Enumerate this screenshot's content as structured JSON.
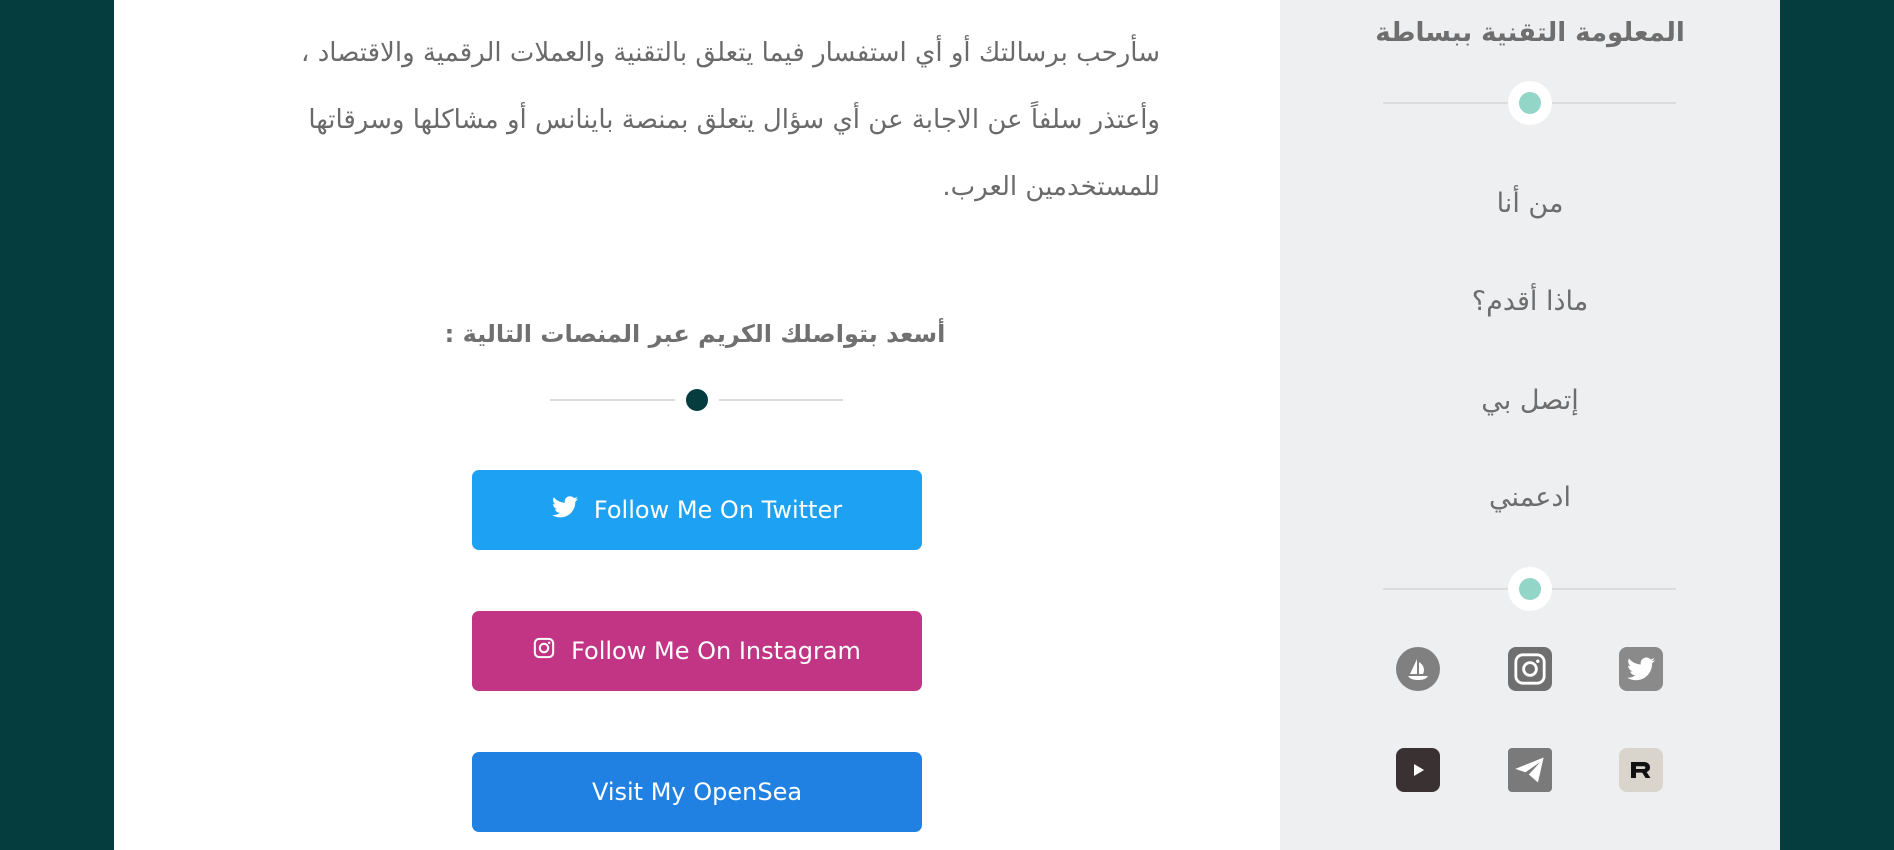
{
  "colors": {
    "outer_background": "#053d3f",
    "sidebar_background": "#eeeff1",
    "sidebar_dot": "#93d5c6",
    "main_dot": "#053d3f",
    "twitter": "#1da1f2",
    "instagram": "#c13584",
    "opensea": "#2081e2"
  },
  "main": {
    "intro_lines": [
      "سأرحب برسالتك أو أي استفسار فيما يتعلق بالتقنية والعملات الرقمية والاقتصاد ،",
      "وأعتذر سلفاً عن الاجابة عن أي سؤال يتعلق بمنصة باينانس أو مشاكلها وسرقاتها",
      "للمستخدمين العرب."
    ],
    "connect_title": "أسعد بتواصلك الكريم عبر المنصات التالية :",
    "buttons": {
      "twitter": {
        "label": "Follow Me On Twitter",
        "icon": "twitter-bird"
      },
      "instagram": {
        "label": "Follow Me On Instagram",
        "icon": "instagram-camera"
      },
      "opensea": {
        "label": "Visit My OpenSea"
      }
    }
  },
  "sidebar": {
    "title": "المعلومة التقنية ببساطة",
    "nav": [
      "من أنا",
      "ماذا أقدم؟",
      "إتصل بي",
      "ادعمني"
    ],
    "social": [
      "opensea-icon",
      "instagram-icon",
      "twitter-icon",
      "youtube-icon",
      "telegram-icon",
      "rarible-icon"
    ]
  }
}
